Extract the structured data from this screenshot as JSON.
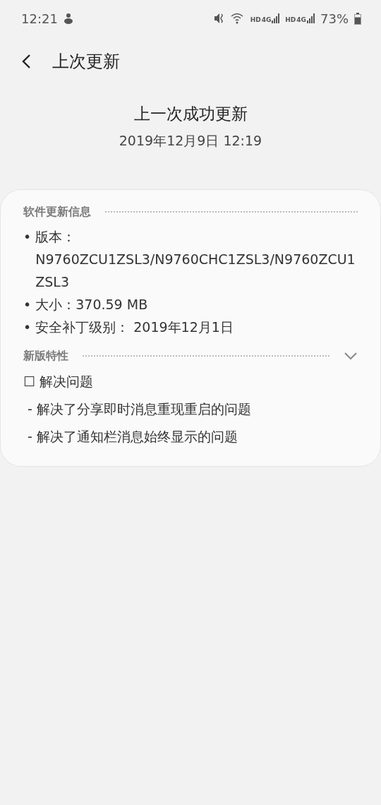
{
  "status_bar": {
    "time": "12:21",
    "networks": [
      {
        "hd": "HD",
        "gen": "4G"
      },
      {
        "hd": "HD",
        "gen": "4G"
      }
    ],
    "battery": "73%"
  },
  "app_bar": {
    "title": "上次更新"
  },
  "summary": {
    "heading": "上一次成功更新",
    "date": "2019年12月9日 12:19"
  },
  "card": {
    "sections": [
      {
        "kind": "info",
        "title": "软件更新信息",
        "items": [
          {
            "bullet": "•",
            "text": "版本：N9760ZCU1ZSL3/N9760CHC1ZSL3/N9760ZCU1ZSL3"
          },
          {
            "bullet": "•",
            "text": "大小：370.59 MB"
          },
          {
            "bullet": "•",
            "text": "安全补丁级别： 2019年12月1日"
          }
        ]
      },
      {
        "kind": "notes",
        "title": "新版特性",
        "lines": [
          "☐ 解决问题",
          " - 解决了分享即时消息重现重启的问题",
          " - 解决了通知栏消息始终显示的问题"
        ]
      }
    ]
  }
}
